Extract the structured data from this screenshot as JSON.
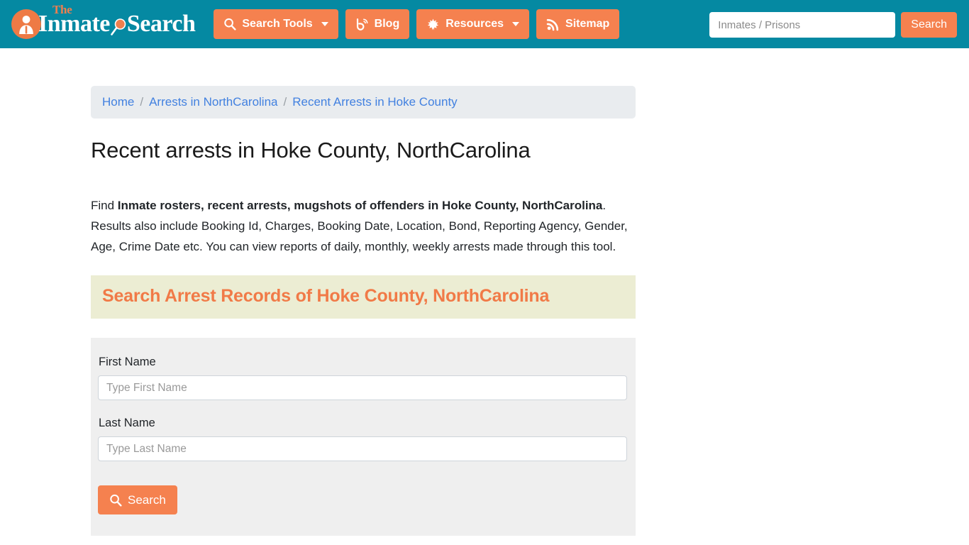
{
  "header": {
    "logo": {
      "the": "The",
      "inmate": "Inmate",
      "search": "Search",
      "person_icon": "person-icon",
      "magnifier_icon": "magnifying-glass-icon"
    },
    "nav": [
      {
        "label": "Search Tools",
        "icon": "magnifying-glass-icon",
        "has_caret": true
      },
      {
        "label": "Blog",
        "icon": "blogger-b-icon",
        "has_caret": false
      },
      {
        "label": "Resources",
        "icon": "leaf-icon",
        "has_caret": true
      },
      {
        "label": "Sitemap",
        "icon": "rss-feed-icon",
        "has_caret": false
      }
    ],
    "search": {
      "placeholder": "Inmates / Prisons",
      "value": "",
      "button_label": "Search"
    },
    "colors": {
      "bar": "#0589a2",
      "accent_orange": "#f5814f"
    }
  },
  "breadcrumb": {
    "items": [
      {
        "label": "Home"
      },
      {
        "label": "Arrests in NorthCarolina"
      },
      {
        "label": "Recent Arrests in Hoke County"
      }
    ],
    "separator": "/"
  },
  "main": {
    "page_title": "Recent arrests in Hoke County, NorthCarolina",
    "lede": {
      "prefix": "Find ",
      "bold": "Inmate rosters, recent arrests, mugshots of offenders in Hoke County, NorthCarolina",
      "suffix": ". Results also include Booking Id, Charges, Booking Date, Location, Bond, Reporting Agency, Gender, Age, Crime Date etc. You can view reports of daily, monthly, weekly arrests made through this tool."
    },
    "section_heading": "Search Arrest Records of Hoke County, NorthCarolina",
    "section_heading_color": "#f17a47",
    "form": {
      "first_name": {
        "label": "First Name",
        "placeholder": "Type First Name",
        "value": ""
      },
      "last_name": {
        "label": "Last Name",
        "placeholder": "Type Last Name",
        "value": ""
      },
      "submit_label": "Search",
      "submit_icon": "magnifying-glass-icon"
    }
  }
}
